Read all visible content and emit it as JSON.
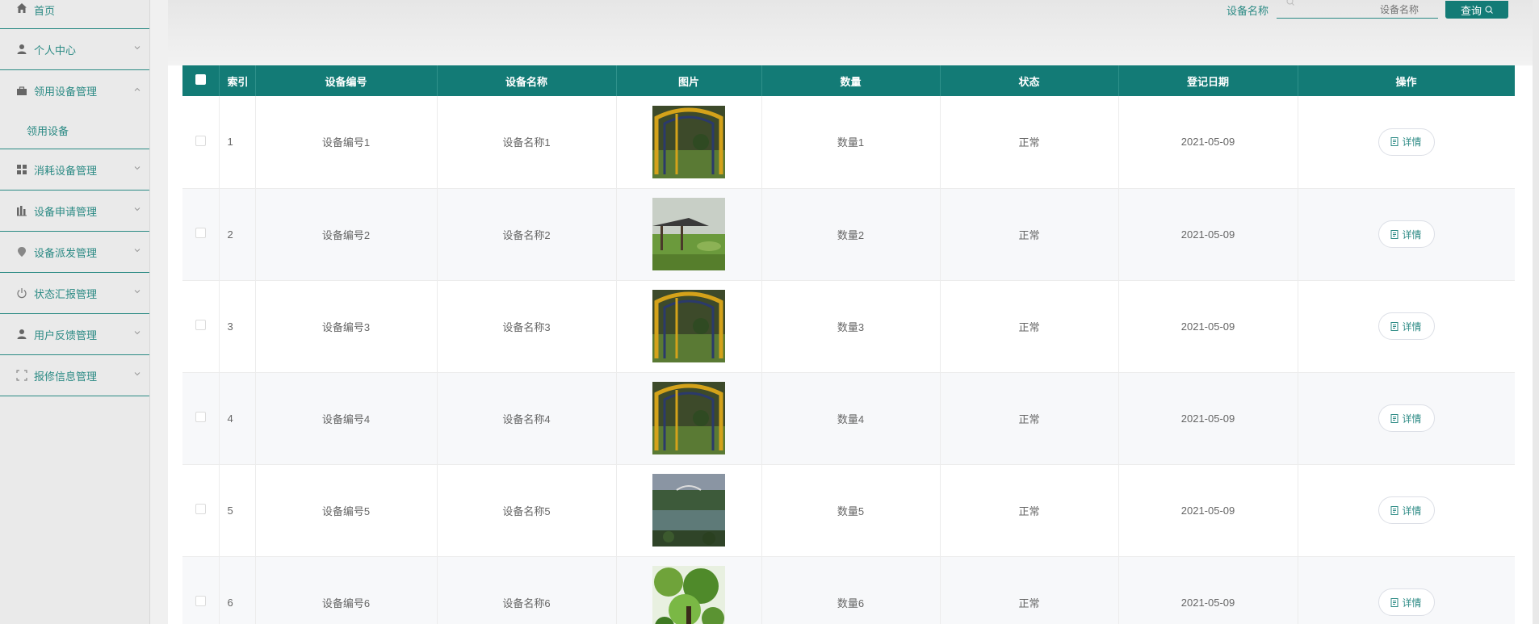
{
  "sidebar": {
    "items": [
      {
        "label": "首页",
        "icon": "home-icon"
      },
      {
        "label": "个人中心",
        "icon": "user-icon"
      },
      {
        "label": "领用设备管理",
        "icon": "briefcase-icon",
        "expanded": true,
        "sub": "领用设备"
      },
      {
        "label": "消耗设备管理",
        "icon": "grid-icon"
      },
      {
        "label": "设备申请管理",
        "icon": "bar-chart-icon"
      },
      {
        "label": "设备派发管理",
        "icon": "location-icon"
      },
      {
        "label": "状态汇报管理",
        "icon": "power-icon"
      },
      {
        "label": "用户反馈管理",
        "icon": "user-icon"
      },
      {
        "label": "报修信息管理",
        "icon": "expand-icon"
      }
    ]
  },
  "search": {
    "label": "设备名称",
    "placeholder": "设备名称",
    "button": "查询"
  },
  "table": {
    "headers": [
      "索引",
      "设备编号",
      "设备名称",
      "图片",
      "数量",
      "状态",
      "登记日期",
      "操作"
    ],
    "detail_label": "详情",
    "rows": [
      {
        "index": "1",
        "code": "设备编号1",
        "name": "设备名称1",
        "qty": "数量1",
        "status": "正常",
        "date": "2021-05-09",
        "image": "rollercoaster"
      },
      {
        "index": "2",
        "code": "设备编号2",
        "name": "设备名称2",
        "qty": "数量2",
        "status": "正常",
        "date": "2021-05-09",
        "image": "pavilion-lawn"
      },
      {
        "index": "3",
        "code": "设备编号3",
        "name": "设备名称3",
        "qty": "数量3",
        "status": "正常",
        "date": "2021-05-09",
        "image": "rollercoaster"
      },
      {
        "index": "4",
        "code": "设备编号4",
        "name": "设备名称4",
        "qty": "数量4",
        "status": "正常",
        "date": "2021-05-09",
        "image": "rollercoaster"
      },
      {
        "index": "5",
        "code": "设备编号5",
        "name": "设备名称5",
        "qty": "数量5",
        "status": "正常",
        "date": "2021-05-09",
        "image": "lake-view"
      },
      {
        "index": "6",
        "code": "设备编号6",
        "name": "设备名称6",
        "qty": "数量6",
        "status": "正常",
        "date": "2021-05-09",
        "image": "forest-tree"
      }
    ]
  },
  "colors": {
    "accent": "#137b76",
    "text": "#2b8a84"
  }
}
